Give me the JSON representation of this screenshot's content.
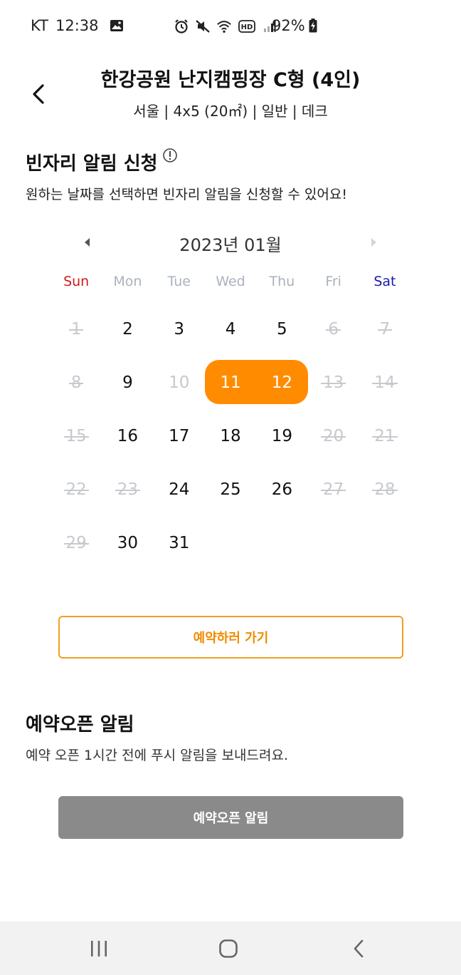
{
  "status_bar": {
    "carrier": "KT",
    "time": "12:38",
    "battery": "92%",
    "icons": [
      "image-icon",
      "alarm-icon",
      "mute-icon",
      "wifi-icon",
      "hd-icon",
      "signal-icon",
      "battery-charging-icon"
    ]
  },
  "header": {
    "title": "한강공원 난지캠핑장 C형 (4인)",
    "subtitle": "서울 | 4x5 (20㎡) | 일반 | 데크"
  },
  "vacancy_alert": {
    "title": "빈자리 알림 신청",
    "description": "원하는 날짜를 선택하면 빈자리 알림을 신청할 수 있어요!"
  },
  "calendar": {
    "month_label": "2023년 01월",
    "weekdays": [
      "Sun",
      "Mon",
      "Tue",
      "Wed",
      "Thu",
      "Fri",
      "Sat"
    ],
    "days": [
      {
        "d": "1",
        "state": "struck"
      },
      {
        "d": "2",
        "state": "available"
      },
      {
        "d": "3",
        "state": "available"
      },
      {
        "d": "4",
        "state": "available"
      },
      {
        "d": "5",
        "state": "available"
      },
      {
        "d": "6",
        "state": "struck"
      },
      {
        "d": "7",
        "state": "struck"
      },
      {
        "d": "8",
        "state": "struck"
      },
      {
        "d": "9",
        "state": "available"
      },
      {
        "d": "10",
        "state": "faded"
      },
      {
        "d": "11",
        "state": "selected"
      },
      {
        "d": "12",
        "state": "selected"
      },
      {
        "d": "13",
        "state": "struck"
      },
      {
        "d": "14",
        "state": "struck"
      },
      {
        "d": "15",
        "state": "struck"
      },
      {
        "d": "16",
        "state": "available"
      },
      {
        "d": "17",
        "state": "available"
      },
      {
        "d": "18",
        "state": "available"
      },
      {
        "d": "19",
        "state": "available"
      },
      {
        "d": "20",
        "state": "struck"
      },
      {
        "d": "21",
        "state": "struck"
      },
      {
        "d": "22",
        "state": "struck"
      },
      {
        "d": "23",
        "state": "struck"
      },
      {
        "d": "24",
        "state": "available"
      },
      {
        "d": "25",
        "state": "available"
      },
      {
        "d": "26",
        "state": "available"
      },
      {
        "d": "27",
        "state": "struck"
      },
      {
        "d": "28",
        "state": "struck"
      },
      {
        "d": "29",
        "state": "struck"
      },
      {
        "d": "30",
        "state": "available"
      },
      {
        "d": "31",
        "state": "available"
      }
    ],
    "selected_color": "#ff8c00"
  },
  "reserve_button": {
    "label": "예약하러 가기",
    "color": "#f08c00"
  },
  "open_alert": {
    "title": "예약오픈 알림",
    "description": "예약 오픈 1시간 전에 푸시 알림을 보내드려요.",
    "button_label": "예약오픈 알림"
  },
  "nav_bar": {
    "icons": [
      "recent-apps-icon",
      "home-icon",
      "back-icon"
    ]
  }
}
